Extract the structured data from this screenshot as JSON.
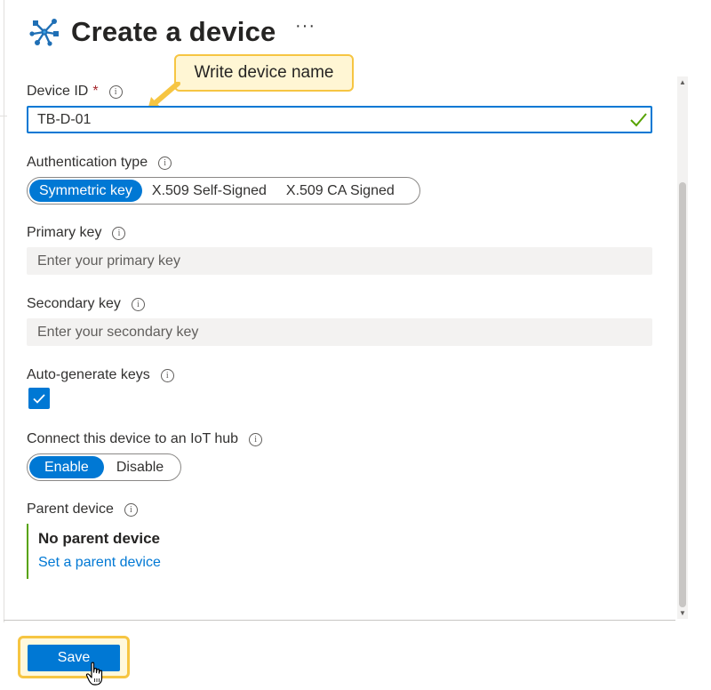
{
  "header": {
    "title": "Create a device",
    "more_label": "···"
  },
  "callout": {
    "text": "Write device name"
  },
  "form": {
    "device_id": {
      "label": "Device ID",
      "required_mark": "*",
      "value": "TB-D-01",
      "valid": true
    },
    "auth_type": {
      "label": "Authentication type",
      "options": [
        "Symmetric key",
        "X.509 Self-Signed",
        "X.509 CA Signed"
      ],
      "selected": "Symmetric key"
    },
    "primary_key": {
      "label": "Primary key",
      "placeholder": "Enter your primary key"
    },
    "secondary_key": {
      "label": "Secondary key",
      "placeholder": "Enter your secondary key"
    },
    "auto_generate": {
      "label": "Auto-generate keys",
      "checked": true
    },
    "connect_hub": {
      "label": "Connect this device to an IoT hub",
      "options": [
        "Enable",
        "Disable"
      ],
      "selected": "Enable"
    },
    "parent_device": {
      "label": "Parent device",
      "value": "No parent device",
      "link": "Set a parent device"
    }
  },
  "footer": {
    "save_label": "Save"
  },
  "info_glyph": "i",
  "icons": [
    "iot-device-icon",
    "info-icon",
    "checkmark-icon",
    "checkbox-check-icon",
    "hand-cursor-icon",
    "callout-arrow-icon"
  ],
  "colors": {
    "accent": "#0078d4",
    "valid": "#57a300",
    "highlight_border": "#f6c542",
    "highlight_fill": "#fff6d4",
    "required": "#a4262c"
  }
}
